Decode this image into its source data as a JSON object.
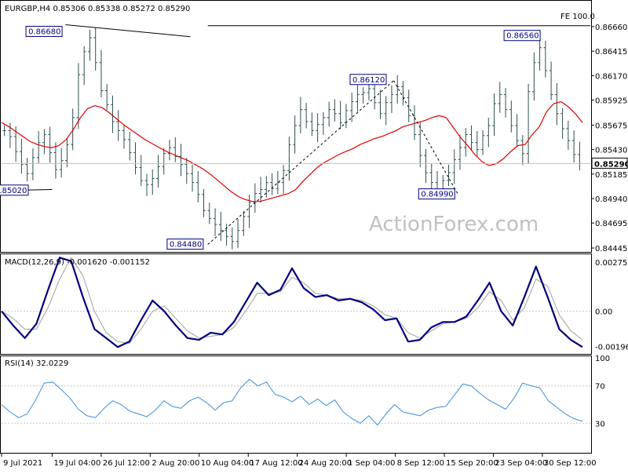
{
  "chart_data": {
    "type": "line",
    "symbol_header": "EURGBP,H4  0.85306 0.85338 0.85272 0.85290",
    "watermark": "ActionForex.com",
    "price_pane": {
      "y_ticks": [
        "0.86660",
        "0.86415",
        "0.86170",
        "0.85925",
        "0.85675",
        "0.85430",
        "0.85185",
        "0.84940",
        "0.84695",
        "0.84445"
      ],
      "ylim": [
        0.84445,
        0.8677
      ],
      "current_price": "0.85290",
      "fe_label": "FE 100.0",
      "annotations": [
        "0.86680",
        "0.86560",
        "0.86120",
        "0.84990",
        "0.84480",
        "0.85020"
      ],
      "close": [
        0.8562,
        0.8556,
        0.8541,
        0.8528,
        0.8519,
        0.8535,
        0.855,
        0.8558,
        0.854,
        0.8523,
        0.8532,
        0.8548,
        0.8575,
        0.8618,
        0.8641,
        0.8655,
        0.863,
        0.8602,
        0.8588,
        0.8571,
        0.8562,
        0.8553,
        0.854,
        0.8525,
        0.8512,
        0.8508,
        0.8514,
        0.8526,
        0.8539,
        0.8545,
        0.8536,
        0.8528,
        0.8519,
        0.851,
        0.8498,
        0.8482,
        0.8474,
        0.8468,
        0.8462,
        0.8456,
        0.8451,
        0.8462,
        0.8476,
        0.849,
        0.8499,
        0.8503,
        0.851,
        0.8504,
        0.851,
        0.8522,
        0.8548,
        0.8567,
        0.8583,
        0.8571,
        0.8562,
        0.8568,
        0.8575,
        0.8583,
        0.8579,
        0.857,
        0.8582,
        0.8591,
        0.8598,
        0.86,
        0.8604,
        0.859,
        0.8579,
        0.859,
        0.8598,
        0.8606,
        0.8595,
        0.8577,
        0.8558,
        0.8537,
        0.852,
        0.851,
        0.8502,
        0.8512,
        0.852,
        0.8533,
        0.8545,
        0.8558,
        0.855,
        0.8543,
        0.8557,
        0.8567,
        0.8589,
        0.8598,
        0.8583,
        0.8567,
        0.8552,
        0.8539,
        0.8601,
        0.863,
        0.8645,
        0.8622,
        0.8598,
        0.8579,
        0.8564,
        0.8552,
        0.8538,
        0.8529
      ],
      "ma": [
        0.857,
        0.8566,
        0.8561,
        0.8556,
        0.8551,
        0.8548,
        0.8546,
        0.8545,
        0.8547,
        0.8553,
        0.8563,
        0.8575,
        0.8584,
        0.8587,
        0.8585,
        0.858,
        0.8574,
        0.8568,
        0.8563,
        0.8558,
        0.8553,
        0.8549,
        0.8545,
        0.8541,
        0.8538,
        0.8535,
        0.8532,
        0.8528,
        0.8524,
        0.8519,
        0.8513,
        0.8507,
        0.8501,
        0.8496,
        0.8493,
        0.8491,
        0.8491,
        0.8493,
        0.8495,
        0.8497,
        0.8499,
        0.8503,
        0.8511,
        0.8518,
        0.8525,
        0.853,
        0.8534,
        0.8538,
        0.8541,
        0.8544,
        0.8548,
        0.8551,
        0.8554,
        0.8556,
        0.8559,
        0.8562,
        0.8566,
        0.8568,
        0.857,
        0.8572,
        0.8575,
        0.8577,
        0.8575,
        0.8565,
        0.8555,
        0.8547,
        0.8538,
        0.8531,
        0.8527,
        0.8529,
        0.8534,
        0.8541,
        0.8547,
        0.8548,
        0.8558,
        0.8566,
        0.8581,
        0.8589,
        0.8591,
        0.8586,
        0.8579,
        0.857
      ]
    },
    "macd_pane": {
      "label": "MACD(12,26,9) -0.001620 -0.001152",
      "y_ticks": [
        "0.002755",
        "0.00",
        "-0.001968"
      ],
      "ylim": [
        -0.0023,
        0.0031
      ],
      "macd": [
        0.0,
        -0.0008,
        -0.0015,
        -0.0007,
        0.0012,
        0.003,
        0.0028,
        0.0008,
        -0.001,
        -0.0015,
        -0.002,
        -0.0017,
        -0.0005,
        0.0006,
        0.0,
        -0.0008,
        -0.0015,
        -0.0016,
        -0.0012,
        -0.0013,
        -0.0006,
        0.0005,
        0.0016,
        0.0009,
        0.0012,
        0.0024,
        0.0013,
        0.0008,
        0.0009,
        0.0006,
        0.0007,
        0.0005,
        0.0001,
        -0.0005,
        -0.0004,
        -0.0017,
        -0.0016,
        -0.0009,
        -0.0006,
        -0.0006,
        -0.0003,
        0.0006,
        0.0016,
        0.0,
        -0.0008,
        0.0008,
        0.0025,
        0.0008,
        -0.001,
        -0.0016,
        -0.002
      ],
      "signal": [
        0.0,
        -0.0004,
        -0.001,
        -0.001,
        0.0002,
        0.0018,
        0.003,
        0.002,
        0.0,
        -0.0012,
        -0.0017,
        -0.0018,
        -0.001,
        0.0,
        0.0003,
        -0.0004,
        -0.0011,
        -0.0015,
        -0.0014,
        -0.0013,
        -0.0009,
        0.0,
        0.001,
        0.001,
        0.0011,
        0.0019,
        0.0016,
        0.001,
        0.0009,
        0.0007,
        0.0007,
        0.0006,
        0.0003,
        -0.0002,
        -0.0004,
        -0.0012,
        -0.0015,
        -0.0011,
        -0.0007,
        -0.0006,
        -0.0004,
        0.0002,
        0.0011,
        0.0006,
        -0.0005,
        0.0002,
        0.0018,
        0.0014,
        -0.0002,
        -0.0011,
        -0.0016
      ]
    },
    "rsi_pane": {
      "label": "RSI(14) 32.0229",
      "y_ticks": [
        "100",
        "70",
        "30",
        "0"
      ],
      "levels": [
        70,
        30
      ],
      "ylim": [
        0,
        100
      ],
      "rsi": [
        50,
        42,
        36,
        40,
        55,
        73,
        74,
        66,
        57,
        45,
        38,
        36,
        46,
        54,
        50,
        43,
        40,
        37,
        44,
        54,
        48,
        46,
        54,
        58,
        52,
        44,
        52,
        54,
        68,
        77,
        70,
        74,
        61,
        58,
        53,
        59,
        50,
        56,
        49,
        55,
        42,
        35,
        30,
        38,
        28,
        40,
        50,
        42,
        40,
        38,
        44,
        47,
        48,
        60,
        72,
        70,
        62,
        55,
        50,
        45,
        57,
        73,
        70,
        68,
        54,
        47,
        40,
        35,
        32
      ]
    },
    "x_ticks": [
      "9 Jul 2021",
      "19 Jul 04:00",
      "26 Jul 12:00",
      "2 Aug 20:00",
      "10 Aug 04:00",
      "17 Aug 12:00",
      "24 Aug 20:00",
      "1 Sep 04:00",
      "8 Sep 12:00",
      "15 Sep 20:00",
      "23 Sep 04:00",
      "30 Sep 12:00"
    ],
    "colors": {
      "candle": "#2f4f4f",
      "ma": "#e00000",
      "macd": "#000080",
      "signal": "#a0a0a0",
      "rsi": "#3a8fd8",
      "tag": "#000080"
    }
  }
}
